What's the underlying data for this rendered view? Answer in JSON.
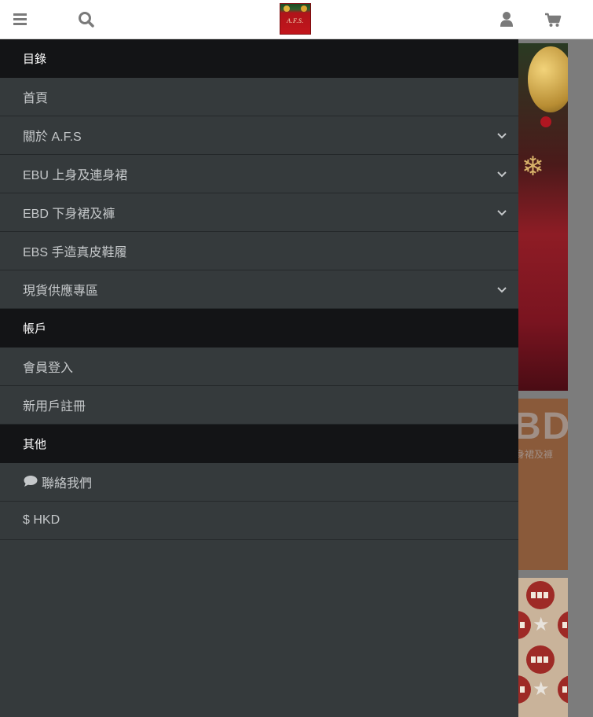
{
  "header": {
    "menu_icon": "hamburger-icon",
    "search_icon": "search-icon",
    "logo_text": "A.F.S.",
    "account_icon": "user-icon",
    "cart_icon": "shopping-cart-icon"
  },
  "menu": {
    "sections": [
      {
        "title": "目錄",
        "items": [
          {
            "label": "首頁",
            "has_submenu": false
          },
          {
            "label": "關於 A.F.S",
            "has_submenu": true
          },
          {
            "label": "EBU 上身及連身裙",
            "has_submenu": true
          },
          {
            "label": "EBD 下身裙及褲",
            "has_submenu": true
          },
          {
            "label": "EBS 手造真皮鞋履",
            "has_submenu": false
          },
          {
            "label": "現貨供應專區",
            "has_submenu": true
          }
        ]
      },
      {
        "title": "帳戶",
        "items": [
          {
            "label": "會員登入",
            "has_submenu": false
          },
          {
            "label": "新用戶註冊",
            "has_submenu": false
          }
        ]
      },
      {
        "title": "其他",
        "items": [
          {
            "label": "聯絡我們",
            "icon": "chat-bubble-icon",
            "has_submenu": false
          },
          {
            "label": "$ HKD",
            "has_submenu": false
          }
        ]
      }
    ]
  },
  "background_banners": {
    "ebd_title": "BD",
    "ebd_subtitle": "身裙及褲"
  },
  "colors": {
    "topbar_bg": "#ffffff",
    "menu_bg": "#353a3c",
    "section_header_bg": "#131416",
    "item_text": "#c5c8ca",
    "icon_gray": "#7a7a7a"
  }
}
